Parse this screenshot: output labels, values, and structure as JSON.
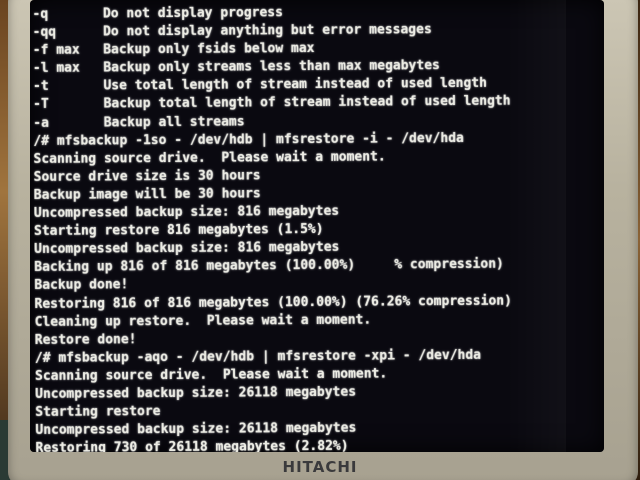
{
  "monitor": {
    "brand": "HITACHI"
  },
  "terminal": {
    "lines": [
      "-q       Do not display progress",
      "-qq      Do not display anything but error messages",
      "-f max   Backup only fsids below max",
      "-l max   Backup only streams less than max megabytes",
      "-t       Use total length of stream instead of used length",
      "-T       Backup total length of stream instead of used length",
      "-a       Backup all streams",
      "/# mfsbackup -1so - /dev/hdb | mfsrestore -i - /dev/hda",
      "Scanning source drive.  Please wait a moment.",
      "Source drive size is 30 hours",
      "Backup image will be 30 hours",
      "Uncompressed backup size: 816 megabytes",
      "Starting restore 816 megabytes (1.5%)",
      "Uncompressed backup size: 816 megabytes",
      "Backing up 816 of 816 megabytes (100.00%)     % compression)",
      "Backup done!",
      "Restoring 816 of 816 megabytes (100.00%) (76.26% compression)",
      "Cleaning up restore.  Please wait a moment.",
      "Restore done!",
      "/# mfsbackup -aqo - /dev/hdb | mfsrestore -xpi - /dev/hda",
      "Scanning source drive.  Please wait a moment.",
      "Uncompressed backup size: 26118 megabytes",
      "Starting restore",
      "Uncompressed backup size: 26118 megabytes",
      "Restoring 730 of 26118 megabytes (2.82%)"
    ]
  },
  "colors": {
    "screen_bg": "#0a0910",
    "text": "#ecece4",
    "bezel": "#bdb7a5"
  }
}
